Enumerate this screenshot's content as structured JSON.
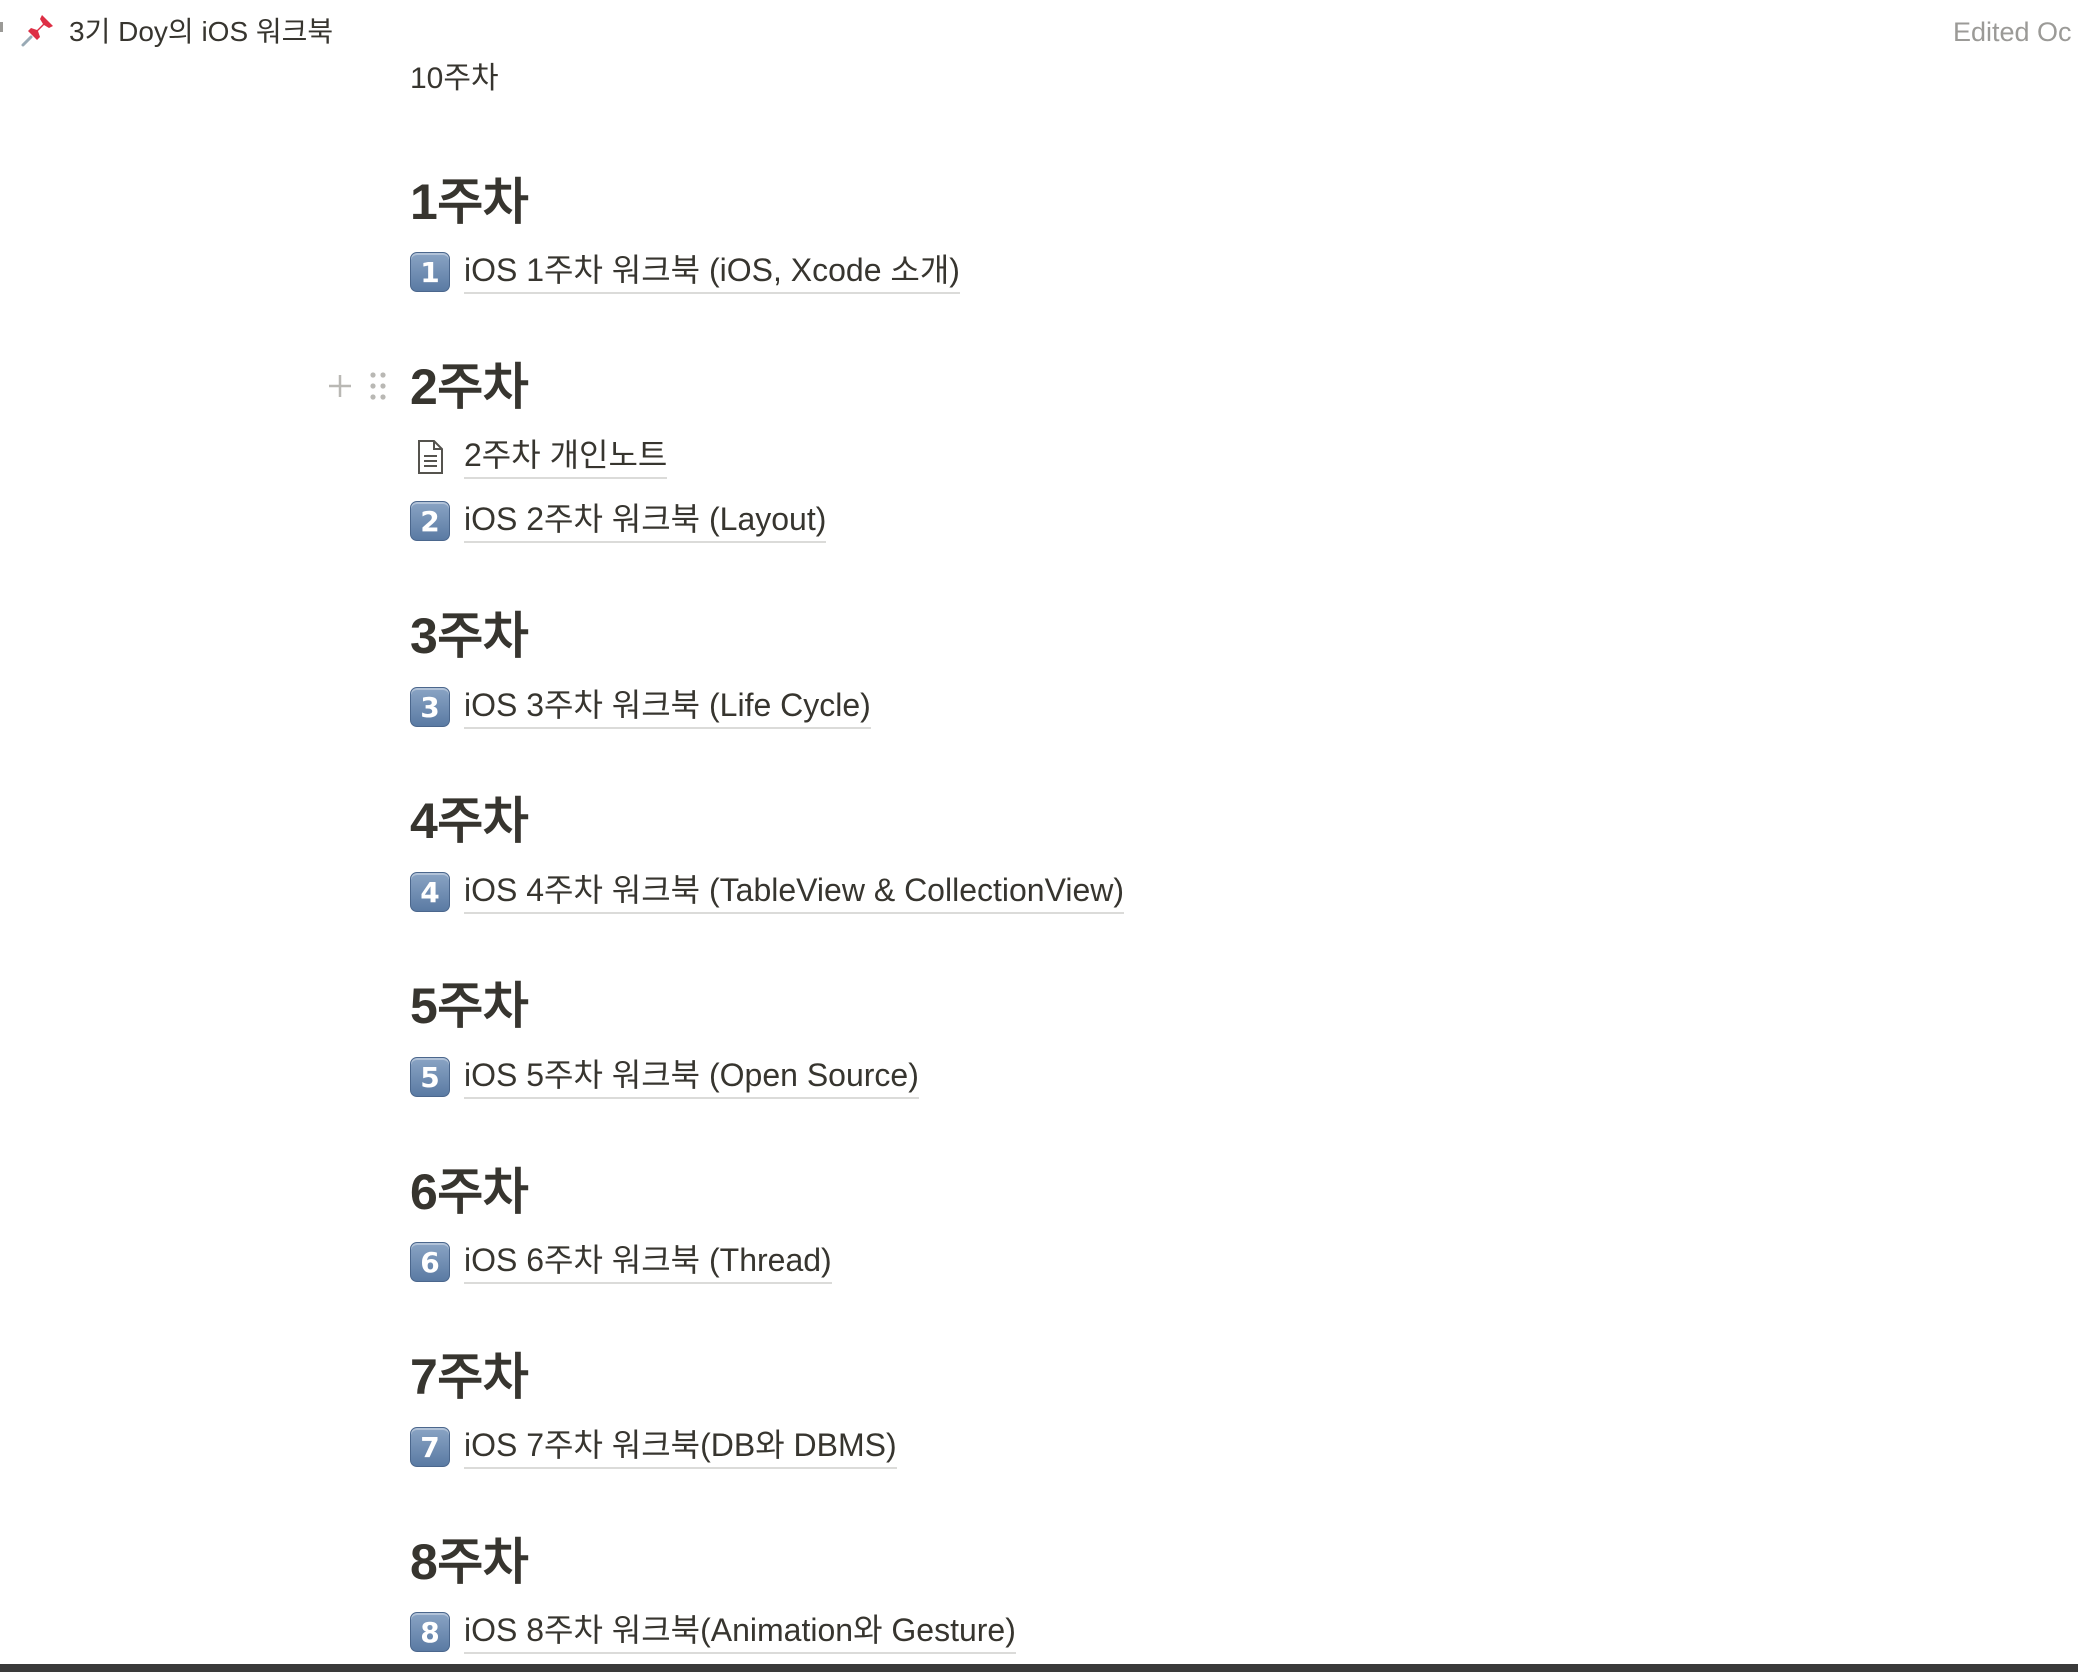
{
  "topbar": {
    "title": "3기 Doy의 iOS 워크북",
    "edited": "Edited Oc"
  },
  "cut_link": "10주차",
  "sections": [
    {
      "heading": "1주차",
      "links": [
        {
          "icon": "keycap-1",
          "keycap": "1",
          "text": "iOS 1주차 워크북 (iOS, Xcode 소개)"
        }
      ]
    },
    {
      "heading": "2주차",
      "links": [
        {
          "icon": "page-icon",
          "text": "2주차 개인노트"
        },
        {
          "icon": "keycap-2",
          "keycap": "2",
          "text": "iOS 2주차 워크북 (Layout)"
        }
      ]
    },
    {
      "heading": "3주차",
      "links": [
        {
          "icon": "keycap-3",
          "keycap": "3",
          "text": "iOS 3주차 워크북 (Life Cycle)"
        }
      ]
    },
    {
      "heading": "4주차",
      "links": [
        {
          "icon": "keycap-4",
          "keycap": "4",
          "text": "iOS 4주차 워크북 (TableView & CollectionView)"
        }
      ]
    },
    {
      "heading": "5주차",
      "links": [
        {
          "icon": "keycap-5",
          "keycap": "5",
          "text": "iOS 5주차 워크북 (Open Source)"
        }
      ]
    },
    {
      "heading": "6주차",
      "links": [
        {
          "icon": "keycap-6",
          "keycap": "6",
          "text": "iOS 6주차 워크북 (Thread)"
        }
      ]
    },
    {
      "heading": "7주차",
      "links": [
        {
          "icon": "keycap-7",
          "keycap": "7",
          "text": "iOS 7주차 워크북(DB와 DBMS)"
        }
      ]
    },
    {
      "heading": "8주차",
      "links": [
        {
          "icon": "keycap-8",
          "keycap": "8",
          "text": "iOS 8주차 워크북(Animation와 Gesture)"
        }
      ]
    }
  ],
  "colors": {
    "text": "#37352f",
    "muted": "#9b9a97",
    "keycap": "#6b8ab0"
  }
}
